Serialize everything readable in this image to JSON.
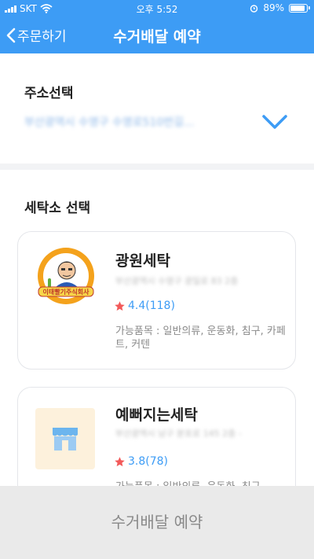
{
  "status_bar": {
    "carrier": "SKT",
    "time": "오후 5:52",
    "battery_percent": "89%",
    "battery_level": 0.89
  },
  "nav": {
    "back_label": "주문하기",
    "title": "수거배달 예약"
  },
  "address": {
    "section_title": "주소선택",
    "value": "부산광역시 수영구 수영로510번길..."
  },
  "stores": {
    "section_title": "세탁소 선택",
    "items": [
      {
        "name": "광원세탁",
        "address": "부산광역시 수영구 광일로 83 2층",
        "rating": "4.4(118)",
        "available_items": "가능품목 : 일반의류, 운동화, 침구, 카페트, 커텐",
        "logo_text": "이태빨기주식회사"
      },
      {
        "name": "예뻐지는세탁",
        "address": "부산광역시 남구 분포로 145 2층 - ",
        "rating": "3.8(78)",
        "available_items": "가능품목 : 일반의류, 운동화, 침구"
      }
    ]
  },
  "bottom_button": {
    "label": "수거배달 예약"
  },
  "colors": {
    "primary": "#3d9cf5",
    "star": "#f25a5a",
    "disabled_bg": "#eaeaea"
  }
}
